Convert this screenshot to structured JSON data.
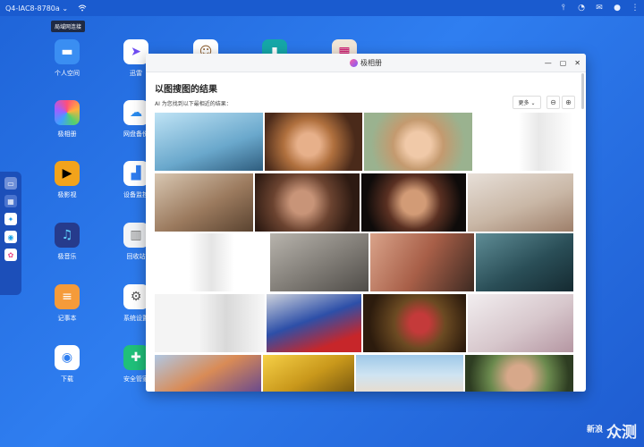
{
  "topbar": {
    "device_name": "Q4-IAC8-8780a ⌄",
    "tooltip": "局域网连接",
    "icons": [
      "pinned-icon",
      "dashboard-icon",
      "mail-icon",
      "user-icon",
      "more-icon"
    ]
  },
  "apps": [
    {
      "label": "个人空间",
      "icon": "folder-icon"
    },
    {
      "label": "迅雷",
      "icon": "thunder-icon"
    },
    {
      "label": "极相册",
      "icon": "photos-icon"
    },
    {
      "label": "网盘备份",
      "icon": "cloud-backup-icon"
    },
    {
      "label": "极影视",
      "icon": "video-icon"
    },
    {
      "label": "设备监控",
      "icon": "monitor-icon"
    },
    {
      "label": "极音乐",
      "icon": "music-icon"
    },
    {
      "label": "回收站",
      "icon": "trash-icon"
    },
    {
      "label": "记事本",
      "icon": "notes-icon"
    },
    {
      "label": "系统设置",
      "icon": "settings-icon"
    },
    {
      "label": "下载",
      "icon": "download-icon"
    },
    {
      "label": "安全管家",
      "icon": "security-icon"
    }
  ],
  "window": {
    "title": "极相册",
    "heading": "以图搜图的结果",
    "subtitle": "AI 为您找到以下最相近的结果：",
    "more_label": "更多 ⌄",
    "zoom_out": "⊖",
    "zoom_in": "⊕"
  },
  "watermark": {
    "brand": "众测",
    "small": "新浪"
  }
}
